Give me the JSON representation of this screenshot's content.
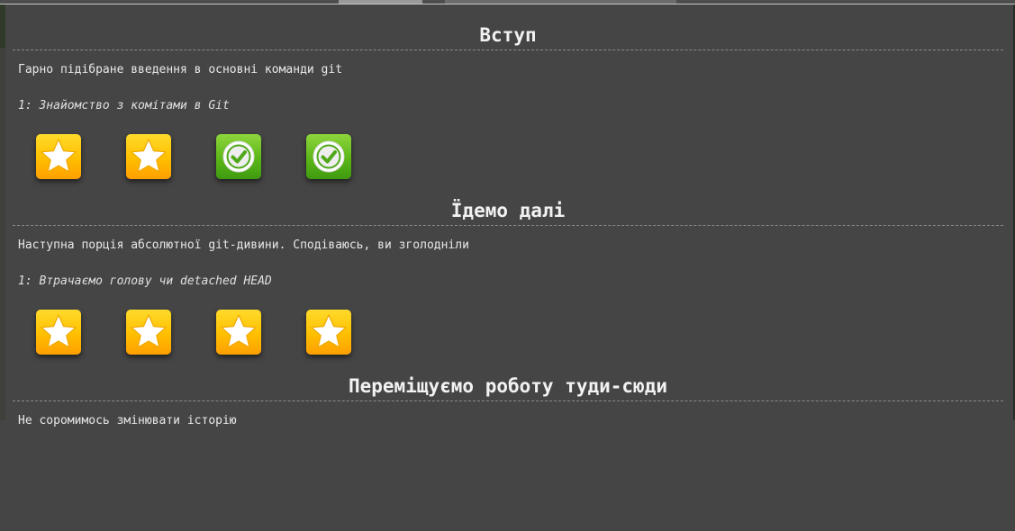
{
  "sections": [
    {
      "title": "Вступ",
      "description": "Гарно підібране введення в основні команди git",
      "level_label": "1: Знайомство з комітами в Git",
      "badges": [
        "star",
        "star",
        "check",
        "check"
      ]
    },
    {
      "title": "Їдемо далі",
      "description": "Наступна порція абсолютної git-дивини. Сподіваюсь, ви зголодніли",
      "level_label": "1: Втрачаємо голову чи detached HEAD",
      "badges": [
        "star",
        "star",
        "star",
        "star"
      ]
    },
    {
      "title": "Переміщуємо роботу туди-сюди",
      "description": "Не соромимось змінювати історію"
    }
  ],
  "colors": {
    "background": "#454545",
    "star_badge": "#ffbf00",
    "check_badge": "#5cb718",
    "rule": "#8a8a8a"
  },
  "icons": {
    "star": "star-icon",
    "check": "check-circle-icon"
  }
}
